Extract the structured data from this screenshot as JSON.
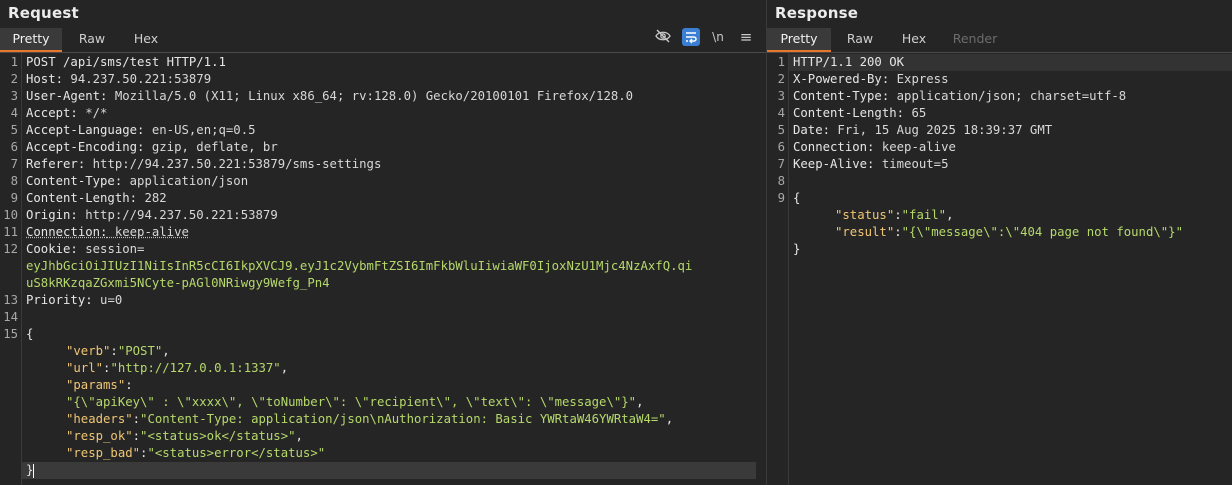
{
  "request": {
    "title": "Request",
    "tabs": [
      "Pretty",
      "Raw",
      "Hex"
    ],
    "active_tab": "Pretty",
    "line_numbers": [
      "1",
      "2",
      "3",
      "4",
      "5",
      "6",
      "7",
      "8",
      "9",
      "10",
      "11",
      "12",
      "13",
      "14",
      "15"
    ],
    "headers": [
      {
        "n": "POST /api/sms/test HTTP/1.1",
        "v": ""
      },
      {
        "n": "Host:",
        "v": " 94.237.50.221:53879"
      },
      {
        "n": "User-Agent:",
        "v": " Mozilla/5.0 (X11; Linux x86_64; rv:128.0) Gecko/20100101 Firefox/128.0"
      },
      {
        "n": "Accept:",
        "v": " */*"
      },
      {
        "n": "Accept-Language:",
        "v": " en-US,en;q=0.5"
      },
      {
        "n": "Accept-Encoding:",
        "v": " gzip, deflate, br"
      },
      {
        "n": "Referer:",
        "v": " http://94.237.50.221:53879/sms-settings"
      },
      {
        "n": "Content-Type:",
        "v": " application/json"
      },
      {
        "n": "Content-Length:",
        "v": " 282"
      },
      {
        "n": "Origin:",
        "v": " http://94.237.50.221:53879"
      },
      {
        "n": "Connection:",
        "v": " keep-alive"
      }
    ],
    "cookie_name": "Cookie:",
    "cookie_key": " session=",
    "cookie_lines": [
      "eyJhbGciOiJIUzI1NiIsInR5cCI6IkpXVCJ9.eyJ1c2VybmFtZSI6ImFkbWluIiwiaWF0IjoxNzU1Mjc4NzAxfQ.qi",
      "uS8kRKzqaZGxmi5NCyte-pAGl0NRiwgy9Wefg_Pn4"
    ],
    "priority_name": "Priority:",
    "priority_value": " u=0",
    "body_open": "{",
    "body": [
      {
        "k": "\"verb\"",
        "s": "\"POST\"",
        "e": ","
      },
      {
        "k": "\"url\"",
        "s": "\"http://127.0.0.1:1337\"",
        "e": ","
      },
      {
        "k": "\"params\"",
        "s": "",
        "e": ""
      },
      {
        "k": "",
        "s": "\"{\\\"apiKey\\\" : \\\"xxxx\\\", \\\"toNumber\\\": \\\"recipient\\\", \\\"text\\\": \\\"message\\\"}\"",
        "e": ","
      },
      {
        "k": "\"headers\"",
        "s": "\"Content-Type: application/json\\nAuthorization: Basic YWRtaW46YWRtaW4=\"",
        "e": ","
      },
      {
        "k": "\"resp_ok\"",
        "s": "\"<status>ok</status>\"",
        "e": ","
      },
      {
        "k": "\"resp_bad\"",
        "s": "\"<status>error</status>\"",
        "e": ""
      }
    ],
    "body_close": "}"
  },
  "response": {
    "title": "Response",
    "tabs": [
      "Pretty",
      "Raw",
      "Hex",
      "Render"
    ],
    "active_tab": "Pretty",
    "line_numbers": [
      "1",
      "2",
      "3",
      "4",
      "5",
      "6",
      "7",
      "8",
      "9"
    ],
    "headers": [
      {
        "n": "HTTP/1.1 200 OK",
        "v": ""
      },
      {
        "n": "X-Powered-By:",
        "v": " Express"
      },
      {
        "n": "Content-Type:",
        "v": " application/json; charset=utf-8"
      },
      {
        "n": "Content-Length:",
        "v": " 65"
      },
      {
        "n": "Date:",
        "v": " Fri, 15 Aug 2025 18:39:37 GMT"
      },
      {
        "n": "Connection:",
        "v": " keep-alive"
      },
      {
        "n": "Keep-Alive:",
        "v": " timeout=5"
      }
    ],
    "body_open": "{",
    "body": [
      {
        "k": "\"status\"",
        "s": "\"fail\"",
        "e": ","
      },
      {
        "k": "\"result\"",
        "s": "\"{\\\"message\\\":\\\"404 page not found\\\"}\"",
        "e": ""
      }
    ],
    "body_close": "}"
  },
  "toolbar": {
    "icons": [
      "hide-eye-icon",
      "word-wrap-icon",
      "newline-icon",
      "menu-icon"
    ],
    "newline_label": "\\n",
    "menu_glyph": "≡"
  },
  "colors": {
    "accent": "#e8772e",
    "json_key": "#f0c674",
    "json_string": "#b6d96b",
    "wrap_button": "#3b7fd4"
  }
}
